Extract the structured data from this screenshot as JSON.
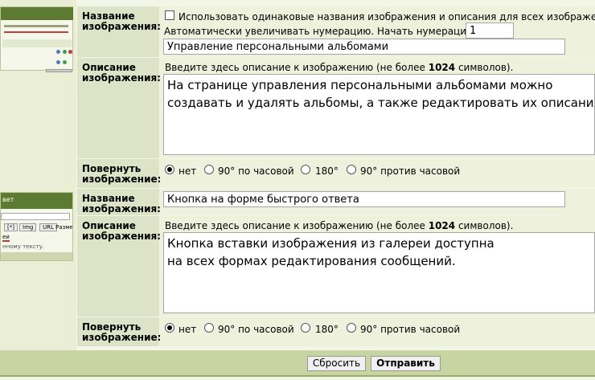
{
  "entries": [
    {
      "name_label": "Название изображения:",
      "same_names_checkbox": "Использовать одинаковые названия изображения и описания для всех изображений.",
      "auto_numbering_label": "Автоматически увеличивать нумерацию. Начать нумерацию с:",
      "start_number": "1",
      "name_value": "Управление персональными альбомами",
      "desc_label": "Описание изображения:",
      "desc_hint_pre": "Введите здесь описание к изображению (не более ",
      "desc_hint_num": "1024",
      "desc_hint_post": " символов).",
      "desc_line1": "На странице управления персональными альбомами можно",
      "desc_line2": "создавать и удалять альбомы, а также редактировать их описания.",
      "rotate_label": "Повернуть изображение:",
      "rotate_options": [
        "нет",
        "90° по часовой",
        "180°",
        "90° против часовой"
      ],
      "rotate_selected": "нет"
    },
    {
      "name_label": "Название изображения:",
      "name_value": "Кнопка на форме быстрого ответа",
      "desc_label": "Описание изображения:",
      "desc_hint_pre": "Введите здесь описание к изображению (не более ",
      "desc_hint_num": "1024",
      "desc_hint_post": " символов).",
      "desc_line1": "Кнопка вставки изображения из галереи доступна",
      "desc_line2": "на всех формах редактирования сообщений.",
      "rotate_label": "Повернуть изображение:",
      "rotate_options": [
        "нет",
        "90° по часовой",
        "180°",
        "90° против часовой"
      ],
      "rotate_selected": "нет"
    }
  ],
  "thumb2": {
    "title": "вет",
    "buttons": [
      "[*]",
      "Img",
      "URL"
    ],
    "size_label": "Размер",
    "line1": "еи",
    "line2": "нному тексту."
  },
  "footer": {
    "reset_label": "Сбросить",
    "submit_label": "Отправить"
  }
}
